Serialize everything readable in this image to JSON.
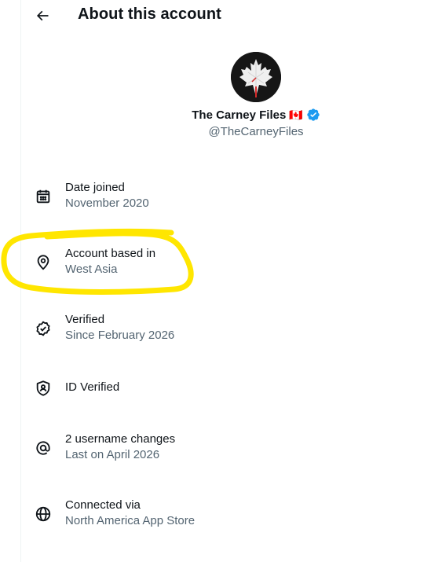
{
  "header": {
    "back_icon": "arrow-left-icon",
    "title": "About this account"
  },
  "profile": {
    "avatar_icon": "maple-leaf-clock-icon",
    "display_name": "The Carney Files",
    "flag": "🇨🇦",
    "verified_icon": "verified-badge-icon",
    "verified_color": "#1d9bf0",
    "handle": "@TheCarneyFiles"
  },
  "items": [
    {
      "icon": "calendar-icon",
      "label": "Date joined",
      "value": "November 2020"
    },
    {
      "icon": "location-pin-icon",
      "label": "Account based in",
      "value": "West Asia"
    },
    {
      "icon": "verified-check-icon",
      "label": "Verified",
      "value": "Since February 2026"
    },
    {
      "icon": "id-shield-icon",
      "label": "ID Verified",
      "value": ""
    },
    {
      "icon": "at-sign-icon",
      "label": "2 username changes",
      "value": "Last on April 2026"
    },
    {
      "icon": "globe-icon",
      "label": "Connected via",
      "value": "North America App Store"
    }
  ],
  "annotation": {
    "color": "#ffe600"
  },
  "colors": {
    "primary_text": "#0f1419",
    "secondary_text": "#536471"
  }
}
